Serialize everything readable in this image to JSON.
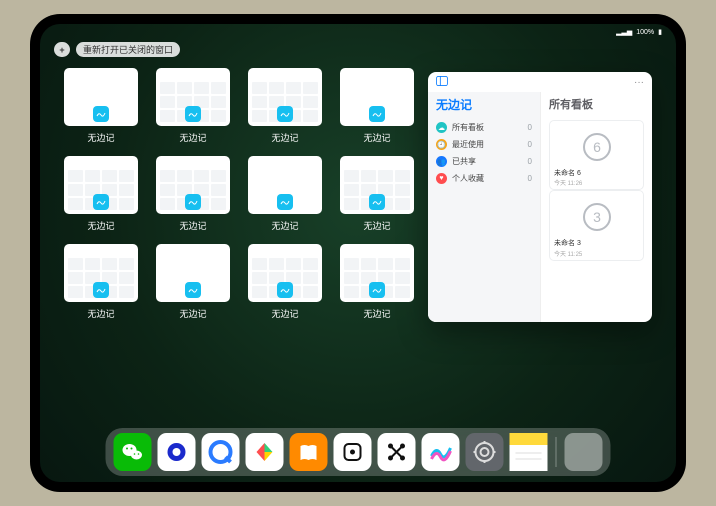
{
  "status": {
    "time": "",
    "network": "▂▃▅",
    "wifi": "�ãWiFi",
    "battery": "100%"
  },
  "topbar": {
    "plus": "+",
    "reopen_label": "重新打开已关闭的窗口"
  },
  "thumb_label": "无边记",
  "thumbs": [
    {
      "variant": "blank"
    },
    {
      "variant": "cal"
    },
    {
      "variant": "cal"
    },
    {
      "variant": "blank"
    },
    {
      "variant": "cal"
    },
    {
      "variant": "cal"
    },
    {
      "variant": "blank"
    },
    {
      "variant": "cal"
    },
    {
      "variant": "cal"
    },
    {
      "variant": "blank"
    },
    {
      "variant": "cal"
    },
    {
      "variant": "cal"
    }
  ],
  "expanded": {
    "back_icon": "sidebar-icon",
    "more": "···",
    "sidebar_title": "无边记",
    "main_title": "所有看板",
    "items": [
      {
        "icon": "cloud",
        "color": "#20c4c4",
        "label": "所有看板",
        "count": 0
      },
      {
        "icon": "clock",
        "color": "#f6a51c",
        "label": "最近使用",
        "count": 0
      },
      {
        "icon": "people",
        "color": "#1677ff",
        "label": "已共享",
        "count": 0
      },
      {
        "icon": "heart",
        "color": "#ff4d4f",
        "label": "个人收藏",
        "count": 0
      }
    ],
    "boards": [
      {
        "name": "未命名 6",
        "sub": "今天 11:26",
        "glyph": "6"
      },
      {
        "name": "未命名 3",
        "sub": "今天 11:25",
        "glyph": "3"
      }
    ]
  },
  "dock": [
    {
      "name": "wechat",
      "bg": "#09bb07"
    },
    {
      "name": "ring-app",
      "bg": "#ffffff"
    },
    {
      "name": "browser-q",
      "bg": "#ffffff"
    },
    {
      "name": "play",
      "bg": "#ffffff"
    },
    {
      "name": "books",
      "bg": "#ff8a00"
    },
    {
      "name": "dice",
      "bg": "#ffffff"
    },
    {
      "name": "share",
      "bg": "#ffffff"
    },
    {
      "name": "freeform",
      "bg": "#ffffff"
    },
    {
      "name": "settings",
      "bg": "#62666b"
    },
    {
      "name": "notes",
      "bg": "#ffffff"
    },
    {
      "name": "appdrawer",
      "bg": "quad"
    }
  ]
}
